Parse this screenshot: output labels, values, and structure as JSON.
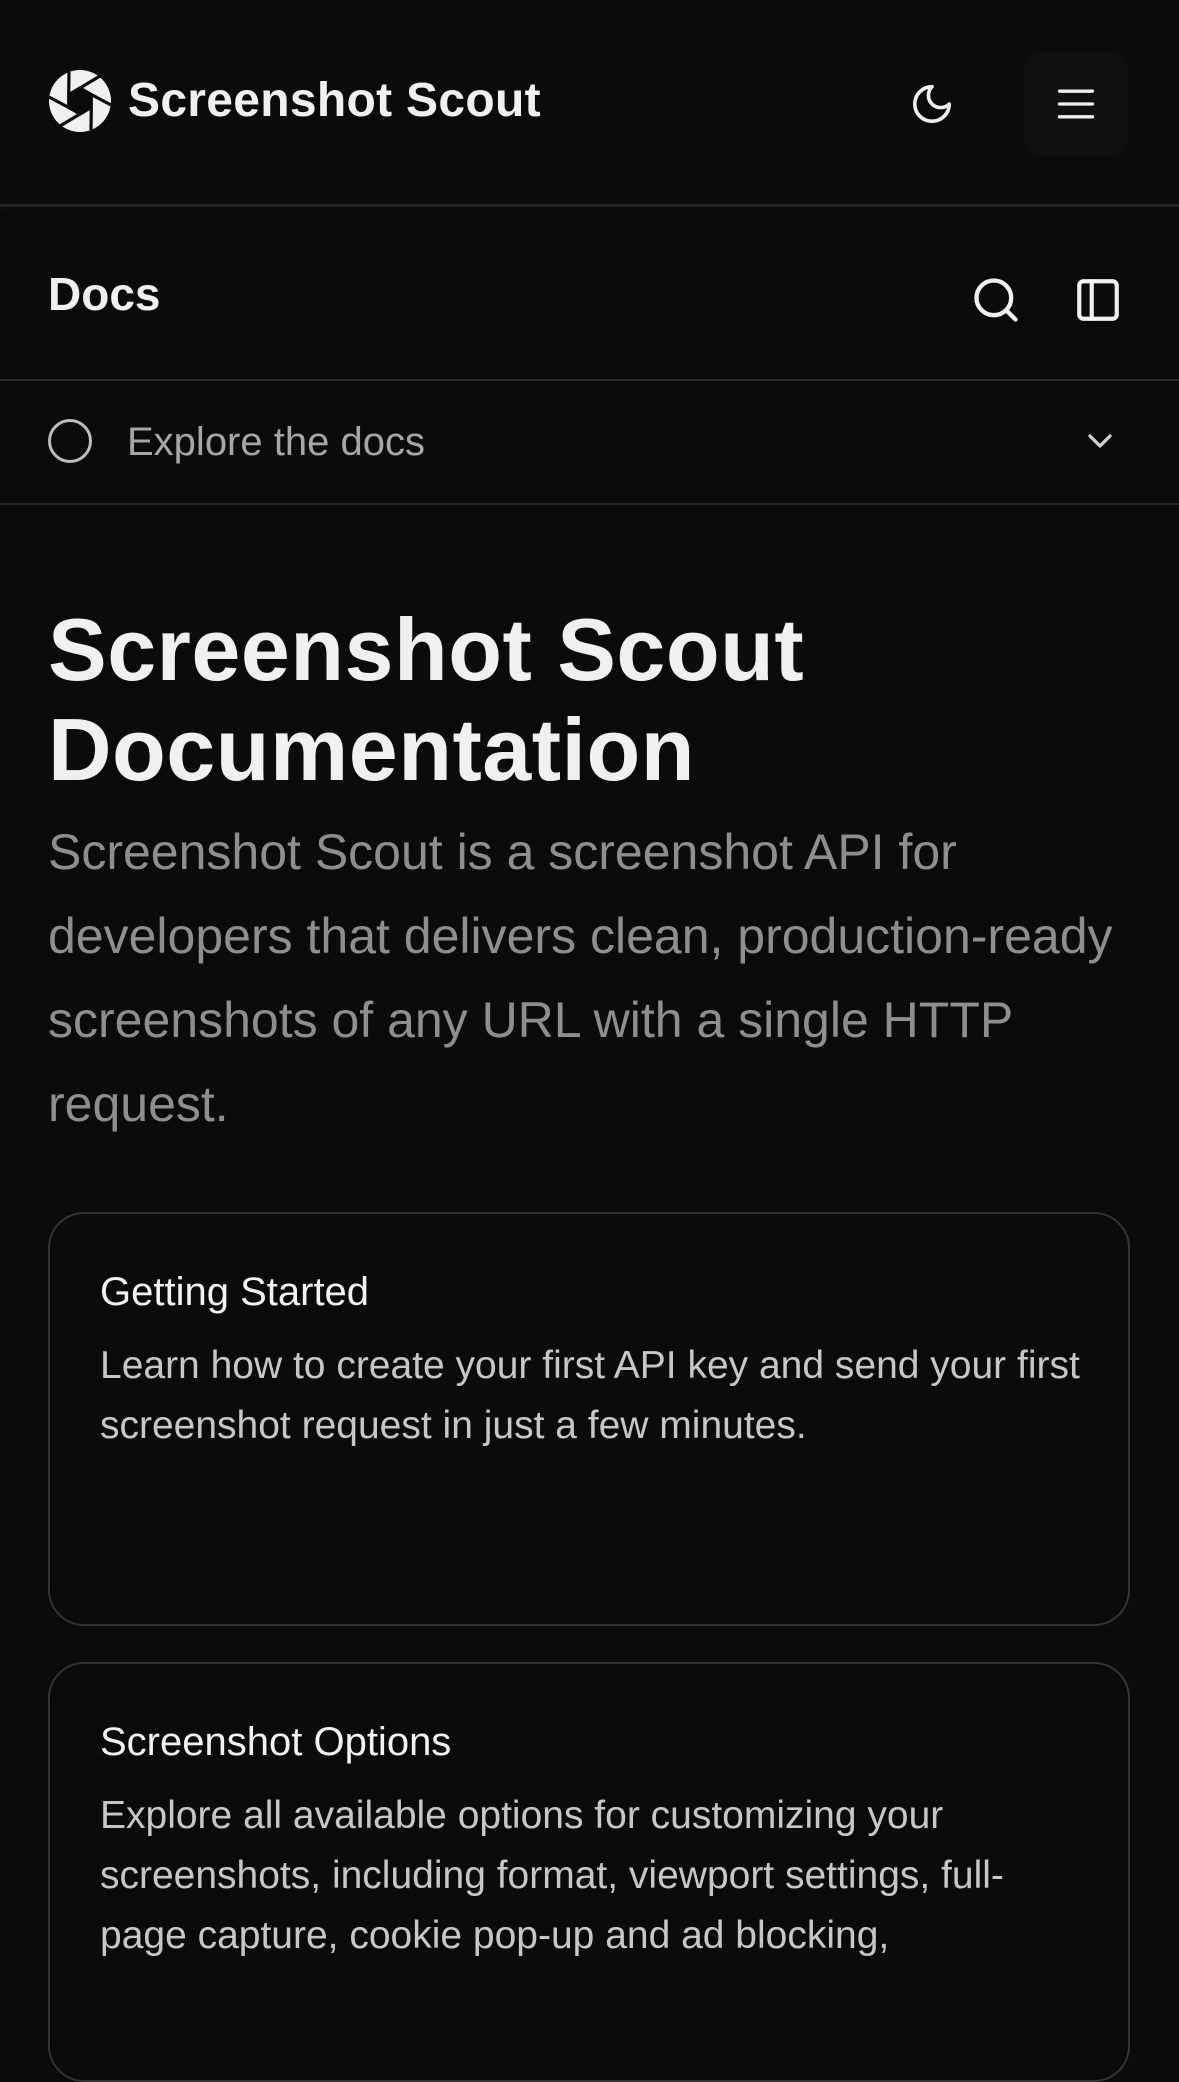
{
  "header": {
    "brand_name": "Screenshot Scout",
    "logo_icon": "aperture-logo-icon",
    "theme_icon": "moon-icon",
    "menu_icon": "hamburger-menu-icon"
  },
  "docs_bar": {
    "title": "Docs",
    "search_icon": "search-icon",
    "sidebar_icon": "sidebar-toggle-icon"
  },
  "explore": {
    "label": "Explore the docs",
    "status_icon": "circle-icon",
    "chevron_icon": "chevron-down-icon"
  },
  "hero": {
    "title": "Screenshot Scout Documentation",
    "description": "Screenshot Scout is a screenshot API for developers that delivers clean, production-ready screenshots of any URL with a single HTTP request."
  },
  "cards": [
    {
      "title": "Getting Started",
      "description": "Learn how to create your first API key and send your first screenshot request in just a few minutes."
    },
    {
      "title": "Screenshot Options",
      "description": "Explore all available options for customizing your screenshots, including format, viewport settings, full-page capture, cookie pop-up and ad blocking,"
    }
  ],
  "colors": {
    "background": "#0b0b0b",
    "text_primary": "#f0f0f0",
    "text_muted": "#8e8e8e",
    "border": "#333333"
  }
}
